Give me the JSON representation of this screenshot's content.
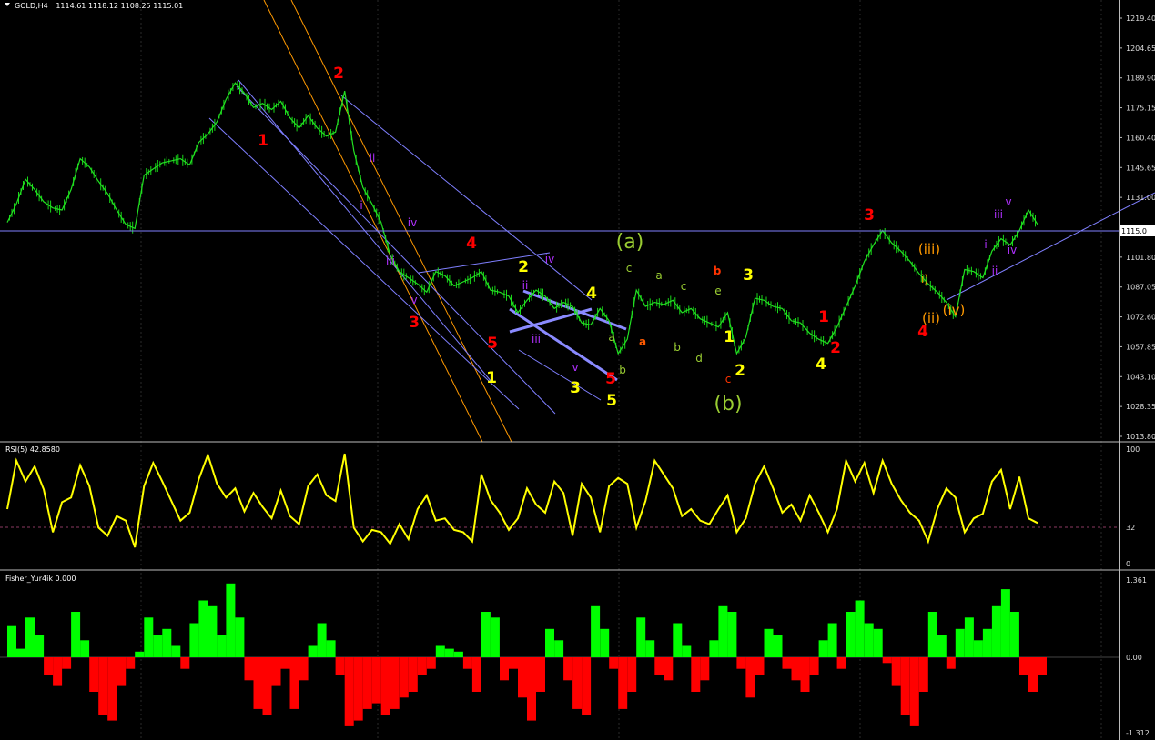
{
  "header": {
    "symbol_title": "GOLD,H4",
    "ohlc": "1114.61 1118.12 1108.25 1115.01"
  },
  "price_pane": {
    "current_price": "1115.0",
    "axis_ticks": [
      "1219.40",
      "1204.65",
      "1189.90",
      "1175.15",
      "1160.40",
      "1145.65",
      "1131.00",
      "1116.25",
      "1101.80",
      "1087.05",
      "1072.60",
      "1057.85",
      "1043.10",
      "1028.35",
      "1013.80"
    ]
  },
  "rsi_pane": {
    "title": "RSI(5) 42.8580",
    "axis_ticks": [
      "100",
      "32",
      "0"
    ]
  },
  "fisher_pane": {
    "title": "Fisher_Yur4ik 0.000",
    "axis_ticks": [
      "1.361",
      "0.00",
      "-1.312"
    ]
  },
  "colors": {
    "background": "#000000",
    "candle": "#18d818",
    "rsi_line": "#ffff00",
    "fisher_pos": "#00ff00",
    "fisher_neg": "#ff0000",
    "trendline": "#7f7fff",
    "fib_line": "#ff9900",
    "grid": "#1e1e1e"
  },
  "chart_data": [
    {
      "type": "line",
      "title": "GOLD,H4",
      "ylim": [
        1013.8,
        1219.4
      ],
      "x": [
        0,
        10,
        20,
        30,
        40,
        50,
        60,
        70,
        80,
        90,
        100,
        110,
        120,
        130,
        140,
        150,
        160,
        170,
        180,
        190,
        200,
        210,
        220,
        230,
        240,
        250,
        260,
        270,
        280,
        290,
        300,
        310,
        320,
        330,
        340,
        350,
        360,
        370,
        380,
        390,
        400,
        410,
        420,
        430,
        440,
        450,
        460,
        470,
        480,
        490,
        500,
        510,
        520,
        530,
        540,
        550,
        560,
        570,
        580,
        590,
        600,
        610,
        620,
        630,
        640,
        650,
        660,
        670,
        680,
        690,
        700,
        710,
        720,
        730,
        740,
        750,
        760,
        770,
        780,
        790,
        800,
        810,
        820,
        830,
        840,
        850,
        860,
        870,
        880,
        890,
        900,
        910,
        920,
        930,
        940,
        950,
        960,
        970,
        980,
        990,
        1000,
        1010,
        1020,
        1030,
        1040,
        1050,
        1060,
        1070,
        1080,
        1090,
        1100,
        1110,
        1120,
        1130
      ],
      "series": [
        {
          "values": [
            1119,
            1128,
            1140,
            1135,
            1129,
            1126,
            1125,
            1135,
            1150,
            1146,
            1139,
            1133,
            1125,
            1118,
            1116,
            1142,
            1145,
            1148,
            1149,
            1150,
            1147,
            1158,
            1162,
            1168,
            1179,
            1187,
            1182,
            1175,
            1177,
            1174,
            1178,
            1170,
            1165,
            1171,
            1165,
            1161,
            1163,
            1183,
            1154,
            1136,
            1128,
            1119,
            1103,
            1095,
            1092,
            1089,
            1085,
            1095,
            1093,
            1088,
            1090,
            1092,
            1095,
            1086,
            1085,
            1083,
            1075,
            1081,
            1086,
            1083,
            1077,
            1080,
            1078,
            1070,
            1069,
            1077,
            1071,
            1055,
            1062,
            1086,
            1078,
            1080,
            1079,
            1081,
            1075,
            1077,
            1072,
            1070,
            1068,
            1075,
            1055,
            1063,
            1082,
            1081,
            1078,
            1077,
            1071,
            1070,
            1065,
            1062,
            1060,
            1068,
            1078,
            1088,
            1100,
            1108,
            1115,
            1109,
            1105,
            1100,
            1094,
            1089,
            1085,
            1080,
            1073,
            1096,
            1095,
            1092,
            1105,
            1111,
            1108,
            1115,
            1125,
            1118
          ]
        }
      ]
    },
    {
      "type": "line",
      "title": "RSI(5) 42.8580",
      "ylim": [
        0,
        100
      ],
      "x": [
        0,
        10,
        20,
        30,
        40,
        50,
        60,
        70,
        80,
        90,
        100,
        110,
        120,
        130,
        140,
        150,
        160,
        170,
        180,
        190,
        200,
        210,
        220,
        230,
        240,
        250,
        260,
        270,
        280,
        290,
        300,
        310,
        320,
        330,
        340,
        350,
        360,
        370,
        380,
        390,
        400,
        410,
        420,
        430,
        440,
        450,
        460,
        470,
        480,
        490,
        500,
        510,
        520,
        530,
        540,
        550,
        560,
        570,
        580,
        590,
        600,
        610,
        620,
        630,
        640,
        650,
        660,
        670,
        680,
        690,
        700,
        710,
        720,
        730,
        740,
        750,
        760,
        770,
        780,
        790,
        800,
        810,
        820,
        830,
        840,
        850,
        860,
        870,
        880,
        890,
        900,
        910,
        920,
        930,
        940,
        950,
        960,
        970,
        980,
        990,
        1000,
        1010,
        1020,
        1030,
        1040,
        1050,
        1060,
        1070,
        1080,
        1090,
        1100,
        1110,
        1120,
        1130
      ],
      "series": [
        {
          "values": [
            48,
            90,
            72,
            85,
            65,
            28,
            54,
            58,
            86,
            68,
            32,
            25,
            42,
            38,
            15,
            68,
            88,
            72,
            55,
            38,
            45,
            74,
            95,
            70,
            58,
            66,
            46,
            62,
            50,
            40,
            64,
            42,
            35,
            68,
            78,
            60,
            55,
            96,
            32,
            20,
            30,
            28,
            18,
            35,
            22,
            48,
            60,
            38,
            40,
            30,
            28,
            20,
            78,
            56,
            45,
            30,
            40,
            66,
            52,
            45,
            72,
            62,
            25,
            70,
            58,
            28,
            68,
            75,
            70,
            32,
            55,
            90,
            78,
            66,
            42,
            48,
            38,
            35,
            48,
            60,
            28,
            40,
            70,
            85,
            66,
            45,
            52,
            38,
            60,
            45,
            28,
            48,
            90,
            72,
            88,
            62,
            90,
            70,
            56,
            45,
            38,
            20,
            48,
            66,
            58,
            28,
            40,
            44,
            72,
            82,
            48,
            76,
            40,
            36
          ]
        }
      ]
    },
    {
      "type": "bar",
      "title": "Fisher_Yur4ik 0.000",
      "ylim": [
        -1.312,
        1.361
      ],
      "x": [
        0,
        10,
        20,
        30,
        40,
        50,
        60,
        70,
        80,
        90,
        100,
        110,
        120,
        130,
        140,
        150,
        160,
        170,
        180,
        190,
        200,
        210,
        220,
        230,
        240,
        250,
        260,
        270,
        280,
        290,
        300,
        310,
        320,
        330,
        340,
        350,
        360,
        370,
        380,
        390,
        400,
        410,
        420,
        430,
        440,
        450,
        460,
        470,
        480,
        490,
        500,
        510,
        520,
        530,
        540,
        550,
        560,
        570,
        580,
        590,
        600,
        610,
        620,
        630,
        640,
        650,
        660,
        670,
        680,
        690,
        700,
        710,
        720,
        730,
        740,
        750,
        760,
        770,
        780,
        790,
        800,
        810,
        820,
        830,
        840,
        850,
        860,
        870,
        880,
        890,
        900,
        910,
        920,
        930,
        940,
        950,
        960,
        970,
        980,
        990,
        1000,
        1010,
        1020,
        1030,
        1040,
        1050,
        1060,
        1070,
        1080,
        1090,
        1100,
        1110,
        1120,
        1130
      ],
      "series": [
        {
          "values": [
            0.55,
            0.15,
            0.7,
            0.4,
            -0.3,
            -0.5,
            -0.2,
            0.8,
            0.3,
            -0.6,
            -1.0,
            -1.1,
            -0.5,
            -0.2,
            0.1,
            0.7,
            0.4,
            0.5,
            0.2,
            -0.2,
            0.6,
            1.0,
            0.9,
            0.4,
            1.3,
            0.7,
            -0.4,
            -0.9,
            -1.0,
            -0.5,
            -0.2,
            -0.9,
            -0.4,
            0.2,
            0.6,
            0.3,
            -0.3,
            -1.2,
            -1.1,
            -0.9,
            -0.8,
            -1.0,
            -0.9,
            -0.7,
            -0.6,
            -0.3,
            -0.2,
            0.2,
            0.15,
            0.1,
            -0.2,
            -0.6,
            0.8,
            0.7,
            -0.4,
            -0.2,
            -0.7,
            -1.1,
            -0.6,
            0.5,
            0.3,
            -0.4,
            -0.9,
            -1.0,
            0.9,
            0.5,
            -0.2,
            -0.9,
            -0.6,
            0.7,
            0.3,
            -0.3,
            -0.4,
            0.6,
            0.2,
            -0.6,
            -0.4,
            0.3,
            0.9,
            0.8,
            -0.2,
            -0.7,
            -0.3,
            0.5,
            0.4,
            -0.2,
            -0.4,
            -0.6,
            -0.3,
            0.3,
            0.6,
            -0.2,
            0.8,
            1.0,
            0.6,
            0.5,
            -0.1,
            -0.5,
            -1.0,
            -1.2,
            -0.6,
            0.8,
            0.4,
            -0.2,
            0.5,
            0.7,
            0.3,
            0.5,
            0.9,
            1.2,
            0.8,
            -0.3,
            -0.6,
            -0.3
          ]
        }
      ]
    }
  ],
  "annotations": [
    {
      "text": "1",
      "color": "#ff0000",
      "x": 289,
      "y": 160
    },
    {
      "text": "2",
      "color": "#ff0000",
      "x": 372,
      "y": 86
    },
    {
      "text": "3",
      "color": "#ff0000",
      "x": 455,
      "y": 360
    },
    {
      "text": "4",
      "color": "#ff0000",
      "x": 518,
      "y": 273
    },
    {
      "text": "5",
      "color": "#ff0000",
      "x": 541,
      "y": 383
    },
    {
      "text": "5",
      "color": "#ff0000",
      "x": 671,
      "y": 422
    },
    {
      "text": "a",
      "color": "#ff5a00",
      "x": 706,
      "y": 380
    },
    {
      "text": "b",
      "color": "#ff3300",
      "x": 788,
      "y": 302
    },
    {
      "text": "c",
      "color": "#ff3300",
      "x": 800,
      "y": 421
    },
    {
      "text": "1",
      "color": "#ff0000",
      "x": 905,
      "y": 354
    },
    {
      "text": "2",
      "color": "#ff0000",
      "x": 918,
      "y": 388
    },
    {
      "text": "3",
      "color": "#ff0000",
      "x": 955,
      "y": 242
    },
    {
      "text": "4",
      "color": "#ff0000",
      "x": 1014,
      "y": 370
    },
    {
      "text": "2",
      "color": "#ffff00",
      "x": 575,
      "y": 299
    },
    {
      "text": "4",
      "color": "#ffff00",
      "x": 650,
      "y": 328
    },
    {
      "text": "1",
      "color": "#ffff00",
      "x": 540,
      "y": 421
    },
    {
      "text": "3",
      "color": "#ffff00",
      "x": 632,
      "y": 432
    },
    {
      "text": "5",
      "color": "#ffff00",
      "x": 672,
      "y": 446
    },
    {
      "text": "3",
      "color": "#ffff00",
      "x": 822,
      "y": 308
    },
    {
      "text": "1",
      "color": "#ffff00",
      "x": 801,
      "y": 376
    },
    {
      "text": "2",
      "color": "#ffff00",
      "x": 813,
      "y": 413
    },
    {
      "text": "4",
      "color": "#ffff00",
      "x": 902,
      "y": 406
    },
    {
      "text": "(a)",
      "color": "#9acd32",
      "x": 692,
      "y": 273
    },
    {
      "text": "(b)",
      "color": "#9acd32",
      "x": 800,
      "y": 451
    },
    {
      "text": "c",
      "color": "#9acd32",
      "x": 691,
      "y": 299
    },
    {
      "text": "a",
      "color": "#9acd32",
      "x": 724,
      "y": 307
    },
    {
      "text": "c",
      "color": "#9acd32",
      "x": 751,
      "y": 319
    },
    {
      "text": "e",
      "color": "#9acd32",
      "x": 789,
      "y": 324
    },
    {
      "text": "b",
      "color": "#9acd32",
      "x": 744,
      "y": 386
    },
    {
      "text": "d",
      "color": "#9acd32",
      "x": 768,
      "y": 398
    },
    {
      "text": "a",
      "color": "#9acd32",
      "x": 672,
      "y": 375
    },
    {
      "text": "b",
      "color": "#9acd32",
      "x": 684,
      "y": 411
    },
    {
      "text": "(iii)",
      "color": "#ff9900",
      "x": 1021,
      "y": 279
    },
    {
      "text": "i)",
      "color": "#ff9900",
      "x": 1016,
      "y": 311
    },
    {
      "text": "(ii)",
      "color": "#ff9900",
      "x": 1023,
      "y": 355
    },
    {
      "text": "(iv)",
      "color": "#ff9900",
      "x": 1048,
      "y": 346
    },
    {
      "text": "ii",
      "color": "#b030ff",
      "x": 409,
      "y": 178
    },
    {
      "text": "i",
      "color": "#b030ff",
      "x": 397,
      "y": 230
    },
    {
      "text": "iv",
      "color": "#b030ff",
      "x": 453,
      "y": 249
    },
    {
      "text": "iii",
      "color": "#b030ff",
      "x": 429,
      "y": 291
    },
    {
      "text": "v",
      "color": "#b030ff",
      "x": 455,
      "y": 334
    },
    {
      "text": "ii",
      "color": "#b030ff",
      "x": 577,
      "y": 318
    },
    {
      "text": "iv",
      "color": "#b030ff",
      "x": 604,
      "y": 289
    },
    {
      "text": "iii",
      "color": "#b030ff",
      "x": 589,
      "y": 377
    },
    {
      "text": "v",
      "color": "#b030ff",
      "x": 632,
      "y": 408
    },
    {
      "text": "iii",
      "color": "#b030ff",
      "x": 1097,
      "y": 240
    },
    {
      "text": "v",
      "color": "#b030ff",
      "x": 1108,
      "y": 226
    },
    {
      "text": "i",
      "color": "#b030ff",
      "x": 1083,
      "y": 273
    },
    {
      "text": "iv",
      "color": "#b030ff",
      "x": 1112,
      "y": 279
    },
    {
      "text": "ii",
      "color": "#b030ff",
      "x": 1093,
      "y": 302
    }
  ]
}
